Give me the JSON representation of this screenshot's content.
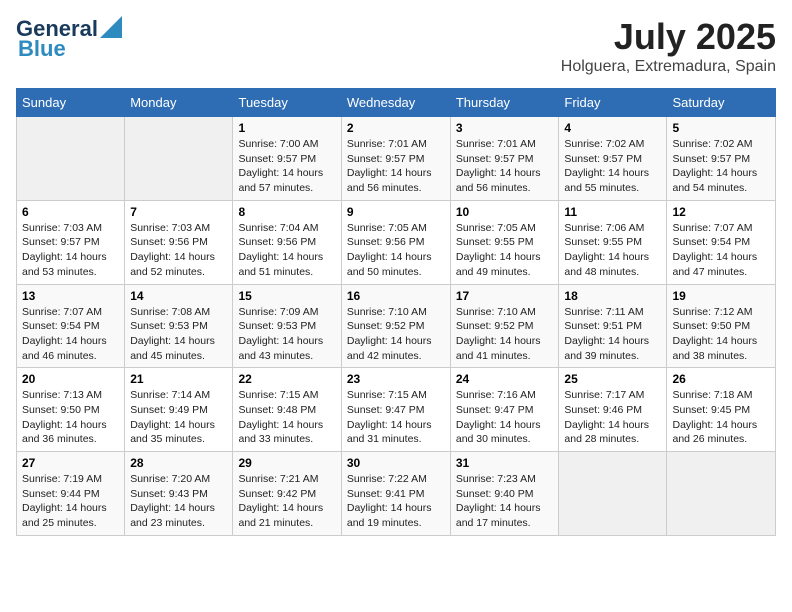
{
  "logo": {
    "line1": "General",
    "line2": "Blue"
  },
  "title": "July 2025",
  "location": "Holguera, Extremadura, Spain",
  "weekdays": [
    "Sunday",
    "Monday",
    "Tuesday",
    "Wednesday",
    "Thursday",
    "Friday",
    "Saturday"
  ],
  "weeks": [
    [
      null,
      null,
      {
        "day": "1",
        "sunrise": "Sunrise: 7:00 AM",
        "sunset": "Sunset: 9:57 PM",
        "daylight": "Daylight: 14 hours and 57 minutes."
      },
      {
        "day": "2",
        "sunrise": "Sunrise: 7:01 AM",
        "sunset": "Sunset: 9:57 PM",
        "daylight": "Daylight: 14 hours and 56 minutes."
      },
      {
        "day": "3",
        "sunrise": "Sunrise: 7:01 AM",
        "sunset": "Sunset: 9:57 PM",
        "daylight": "Daylight: 14 hours and 56 minutes."
      },
      {
        "day": "4",
        "sunrise": "Sunrise: 7:02 AM",
        "sunset": "Sunset: 9:57 PM",
        "daylight": "Daylight: 14 hours and 55 minutes."
      },
      {
        "day": "5",
        "sunrise": "Sunrise: 7:02 AM",
        "sunset": "Sunset: 9:57 PM",
        "daylight": "Daylight: 14 hours and 54 minutes."
      }
    ],
    [
      {
        "day": "6",
        "sunrise": "Sunrise: 7:03 AM",
        "sunset": "Sunset: 9:57 PM",
        "daylight": "Daylight: 14 hours and 53 minutes."
      },
      {
        "day": "7",
        "sunrise": "Sunrise: 7:03 AM",
        "sunset": "Sunset: 9:56 PM",
        "daylight": "Daylight: 14 hours and 52 minutes."
      },
      {
        "day": "8",
        "sunrise": "Sunrise: 7:04 AM",
        "sunset": "Sunset: 9:56 PM",
        "daylight": "Daylight: 14 hours and 51 minutes."
      },
      {
        "day": "9",
        "sunrise": "Sunrise: 7:05 AM",
        "sunset": "Sunset: 9:56 PM",
        "daylight": "Daylight: 14 hours and 50 minutes."
      },
      {
        "day": "10",
        "sunrise": "Sunrise: 7:05 AM",
        "sunset": "Sunset: 9:55 PM",
        "daylight": "Daylight: 14 hours and 49 minutes."
      },
      {
        "day": "11",
        "sunrise": "Sunrise: 7:06 AM",
        "sunset": "Sunset: 9:55 PM",
        "daylight": "Daylight: 14 hours and 48 minutes."
      },
      {
        "day": "12",
        "sunrise": "Sunrise: 7:07 AM",
        "sunset": "Sunset: 9:54 PM",
        "daylight": "Daylight: 14 hours and 47 minutes."
      }
    ],
    [
      {
        "day": "13",
        "sunrise": "Sunrise: 7:07 AM",
        "sunset": "Sunset: 9:54 PM",
        "daylight": "Daylight: 14 hours and 46 minutes."
      },
      {
        "day": "14",
        "sunrise": "Sunrise: 7:08 AM",
        "sunset": "Sunset: 9:53 PM",
        "daylight": "Daylight: 14 hours and 45 minutes."
      },
      {
        "day": "15",
        "sunrise": "Sunrise: 7:09 AM",
        "sunset": "Sunset: 9:53 PM",
        "daylight": "Daylight: 14 hours and 43 minutes."
      },
      {
        "day": "16",
        "sunrise": "Sunrise: 7:10 AM",
        "sunset": "Sunset: 9:52 PM",
        "daylight": "Daylight: 14 hours and 42 minutes."
      },
      {
        "day": "17",
        "sunrise": "Sunrise: 7:10 AM",
        "sunset": "Sunset: 9:52 PM",
        "daylight": "Daylight: 14 hours and 41 minutes."
      },
      {
        "day": "18",
        "sunrise": "Sunrise: 7:11 AM",
        "sunset": "Sunset: 9:51 PM",
        "daylight": "Daylight: 14 hours and 39 minutes."
      },
      {
        "day": "19",
        "sunrise": "Sunrise: 7:12 AM",
        "sunset": "Sunset: 9:50 PM",
        "daylight": "Daylight: 14 hours and 38 minutes."
      }
    ],
    [
      {
        "day": "20",
        "sunrise": "Sunrise: 7:13 AM",
        "sunset": "Sunset: 9:50 PM",
        "daylight": "Daylight: 14 hours and 36 minutes."
      },
      {
        "day": "21",
        "sunrise": "Sunrise: 7:14 AM",
        "sunset": "Sunset: 9:49 PM",
        "daylight": "Daylight: 14 hours and 35 minutes."
      },
      {
        "day": "22",
        "sunrise": "Sunrise: 7:15 AM",
        "sunset": "Sunset: 9:48 PM",
        "daylight": "Daylight: 14 hours and 33 minutes."
      },
      {
        "day": "23",
        "sunrise": "Sunrise: 7:15 AM",
        "sunset": "Sunset: 9:47 PM",
        "daylight": "Daylight: 14 hours and 31 minutes."
      },
      {
        "day": "24",
        "sunrise": "Sunrise: 7:16 AM",
        "sunset": "Sunset: 9:47 PM",
        "daylight": "Daylight: 14 hours and 30 minutes."
      },
      {
        "day": "25",
        "sunrise": "Sunrise: 7:17 AM",
        "sunset": "Sunset: 9:46 PM",
        "daylight": "Daylight: 14 hours and 28 minutes."
      },
      {
        "day": "26",
        "sunrise": "Sunrise: 7:18 AM",
        "sunset": "Sunset: 9:45 PM",
        "daylight": "Daylight: 14 hours and 26 minutes."
      }
    ],
    [
      {
        "day": "27",
        "sunrise": "Sunrise: 7:19 AM",
        "sunset": "Sunset: 9:44 PM",
        "daylight": "Daylight: 14 hours and 25 minutes."
      },
      {
        "day": "28",
        "sunrise": "Sunrise: 7:20 AM",
        "sunset": "Sunset: 9:43 PM",
        "daylight": "Daylight: 14 hours and 23 minutes."
      },
      {
        "day": "29",
        "sunrise": "Sunrise: 7:21 AM",
        "sunset": "Sunset: 9:42 PM",
        "daylight": "Daylight: 14 hours and 21 minutes."
      },
      {
        "day": "30",
        "sunrise": "Sunrise: 7:22 AM",
        "sunset": "Sunset: 9:41 PM",
        "daylight": "Daylight: 14 hours and 19 minutes."
      },
      {
        "day": "31",
        "sunrise": "Sunrise: 7:23 AM",
        "sunset": "Sunset: 9:40 PM",
        "daylight": "Daylight: 14 hours and 17 minutes."
      },
      null,
      null
    ]
  ]
}
